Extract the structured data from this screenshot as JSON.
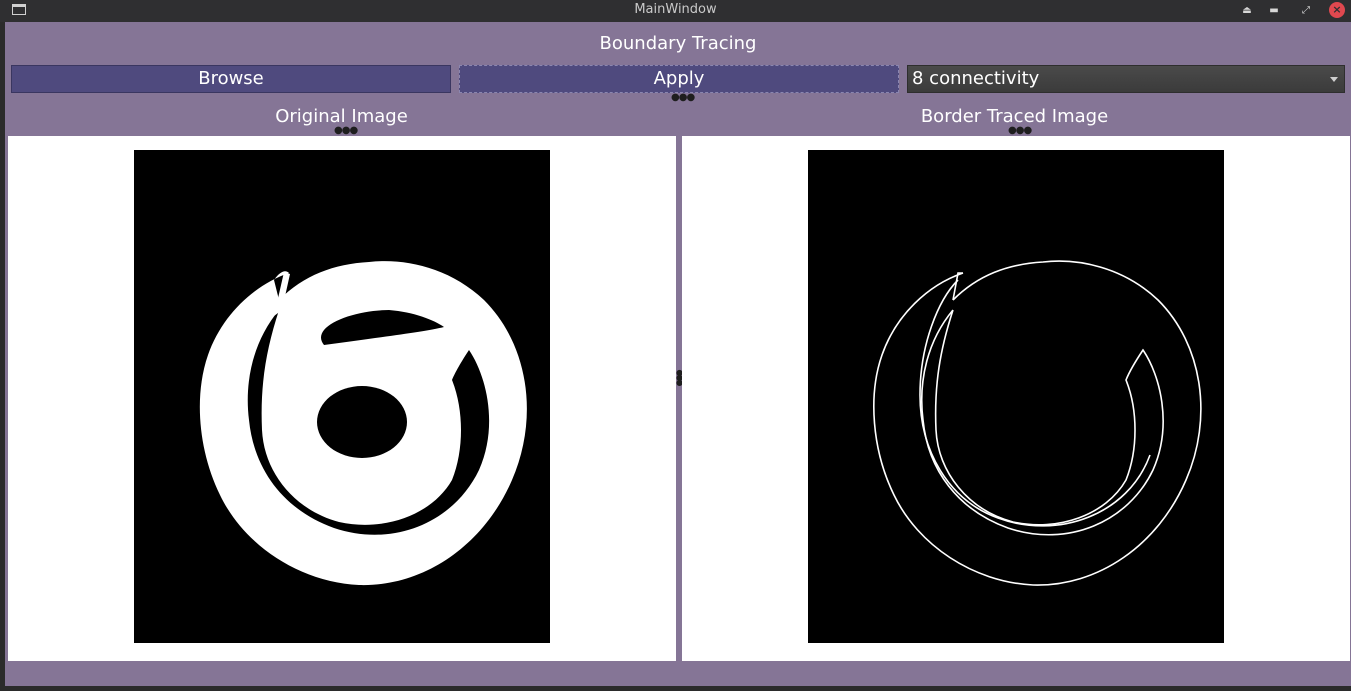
{
  "window": {
    "title": "MainWindow"
  },
  "app": {
    "heading": "Boundary Tracing"
  },
  "toolbar": {
    "browse_label": "Browse",
    "apply_label": "Apply",
    "connectivity": {
      "selected": "8 connectivity"
    }
  },
  "panels": {
    "original_label": "Original Image",
    "traced_label": "Border Traced Image"
  },
  "icons": {
    "keep_above": "eject-icon",
    "minimize": "minimize-icon",
    "maximize": "maximize-icon",
    "close": "close-icon"
  },
  "colors": {
    "window_bg": "#857596",
    "button_bg": "#4f4a7e",
    "titlebar_bg": "#2f2f31",
    "close_button": "#e0484f"
  }
}
